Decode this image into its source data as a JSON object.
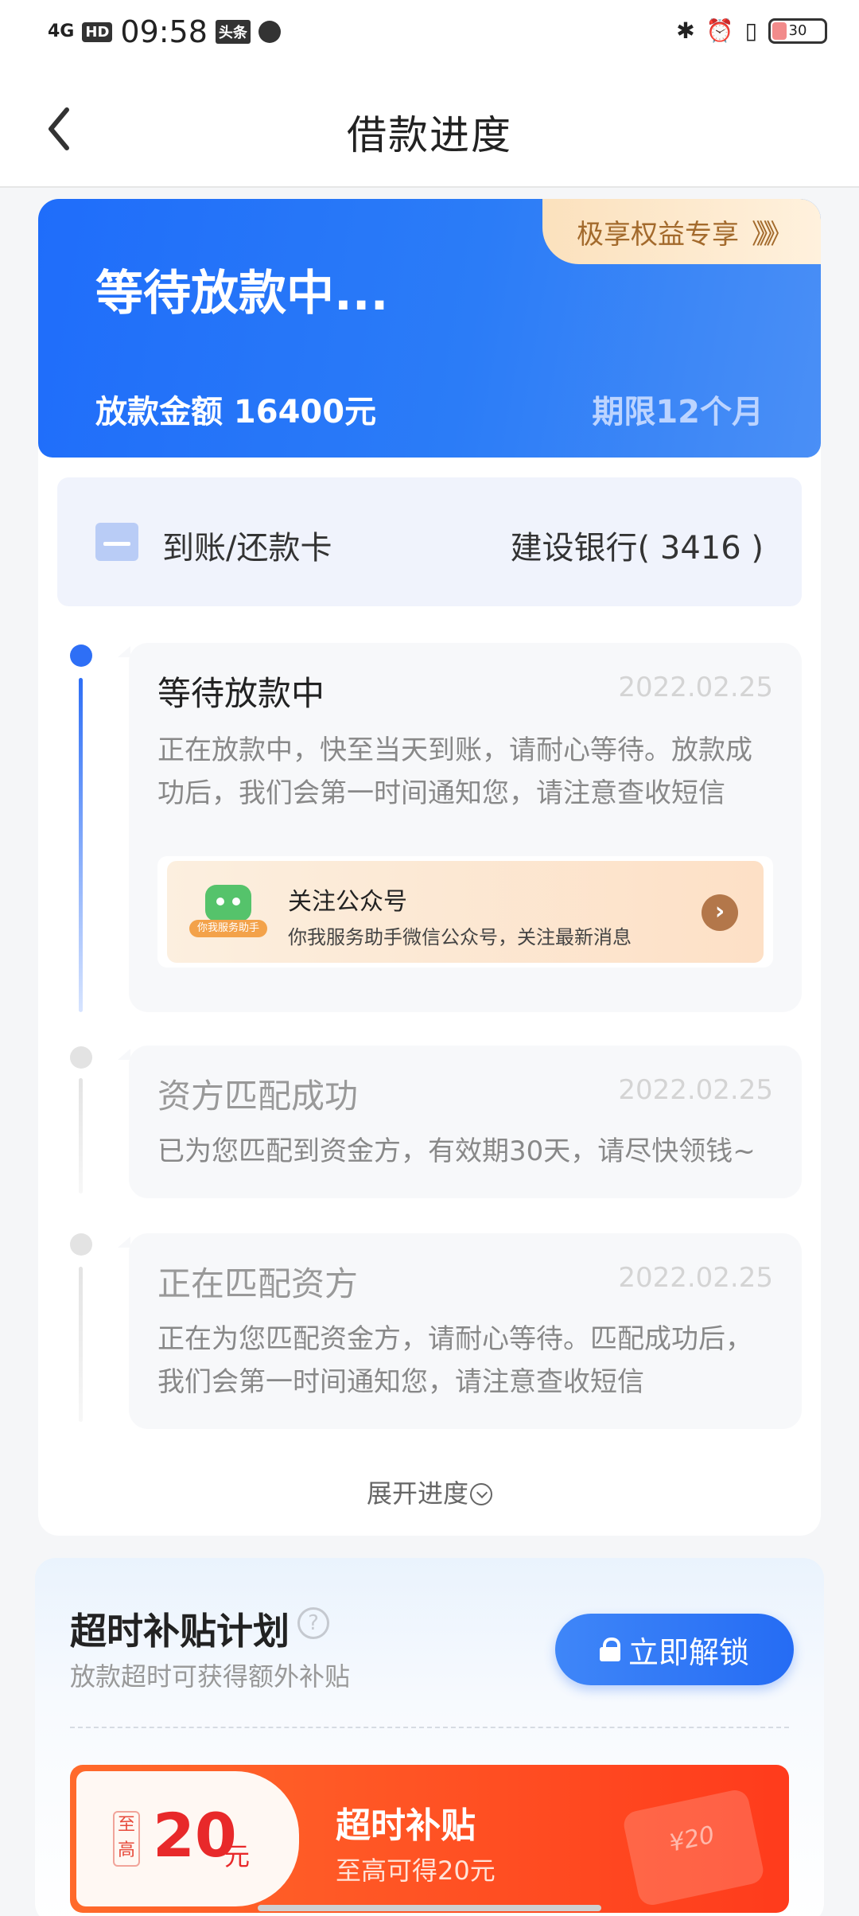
{
  "status_bar": {
    "signal": "4G",
    "hd": "HD",
    "time": "09:58",
    "app_badge": "头条",
    "battery": "30"
  },
  "nav": {
    "title": "借款进度"
  },
  "hero": {
    "status": "等待放款中...",
    "benefit_label": "极享权益专享",
    "benefit_arrows": "》》》",
    "amount": "放款金额 16400元",
    "term": "期限12个月"
  },
  "bank": {
    "label": "到账/还款卡",
    "value": "建设银行( 3416 )"
  },
  "steps": [
    {
      "title": "等待放款中",
      "date": "2022.02.25",
      "desc": "正在放款中，快至当天到账，请耐心等待。放款成功后，我们会第一时间通知您，请注意查收短信"
    },
    {
      "title": "资方匹配成功",
      "date": "2022.02.25",
      "desc": "已为您匹配到资金方，有效期30天，请尽快领钱~"
    },
    {
      "title": "正在匹配资方",
      "date": "2022.02.25",
      "desc": "正在为您匹配资金方，请耐心等待。匹配成功后，我们会第一时间通知您，请注意查收短信"
    }
  ],
  "follow": {
    "badge": "你我服务助手",
    "title": "关注公众号",
    "subtitle": "你我服务助手微信公众号，关注最新消息"
  },
  "expand_label": "展开进度",
  "subsidy": {
    "title": "超时补贴计划",
    "help": "?",
    "desc": "放款超时可获得额外补贴",
    "unlock_label": "立即解锁",
    "coupon": {
      "max_tag": "至高",
      "amount": "20",
      "unit": "元",
      "title": "超时补贴",
      "subtitle": "至高可得20元",
      "deco": "¥20"
    }
  },
  "colors": {
    "primary": "#2e6ff6",
    "hero_gradient_start": "#1f6dfa",
    "benefit_text": "#a36a2c",
    "coupon_red": "#ff3b1c"
  }
}
